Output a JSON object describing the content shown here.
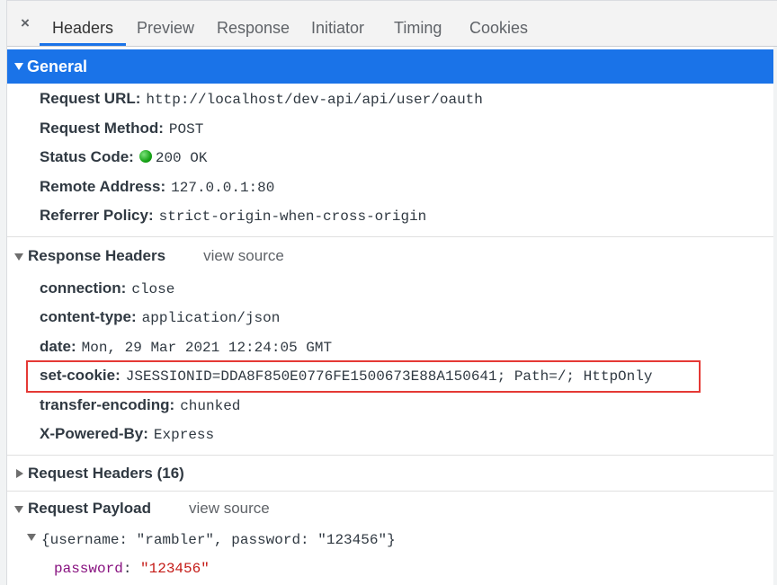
{
  "tabs": {
    "close_glyph": "×",
    "items": [
      "Headers",
      "Preview",
      "Response",
      "Initiator",
      "Timing",
      "Cookies"
    ],
    "active": "Headers"
  },
  "general": {
    "title": "General",
    "rows": [
      {
        "key": "Request URL:",
        "value": "http://localhost/dev-api/api/user/oauth"
      },
      {
        "key": "Request Method:",
        "value": "POST"
      },
      {
        "key": "Status Code:",
        "value": "200 OK"
      },
      {
        "key": "Remote Address:",
        "value": "127.0.0.1:80"
      },
      {
        "key": "Referrer Policy:",
        "value": "strict-origin-when-cross-origin"
      }
    ]
  },
  "response_headers": {
    "title": "Response Headers",
    "view_source": "view source",
    "rows": [
      {
        "key": "connection:",
        "value": "close"
      },
      {
        "key": "content-type:",
        "value": "application/json"
      },
      {
        "key": "date:",
        "value": "Mon, 29 Mar 2021 12:24:05 GMT"
      },
      {
        "key": "set-cookie:",
        "value": "JSESSIONID=DDA8F850E0776FE1500673E88A150641; Path=/; HttpOnly"
      },
      {
        "key": "transfer-encoding:",
        "value": "chunked"
      },
      {
        "key": "X-Powered-By:",
        "value": "Express"
      }
    ]
  },
  "request_headers": {
    "title": "Request Headers (16)"
  },
  "request_payload": {
    "title": "Request Payload",
    "view_source": "view source",
    "summary": "{username: \"rambler\", password: \"123456\"}",
    "props": [
      {
        "key": "password",
        "sep": ": ",
        "value": "\"123456\""
      }
    ]
  },
  "colors": {
    "accent": "#1a73e8",
    "highlight_border": "#e53935",
    "status_ok": "#17a317",
    "prop_key": "#881280",
    "prop_string": "#c41a16"
  },
  "icons": {
    "close": "close-icon",
    "expanded": "triangle-down-icon",
    "collapsed": "triangle-right-icon",
    "status": "status-dot-icon"
  }
}
